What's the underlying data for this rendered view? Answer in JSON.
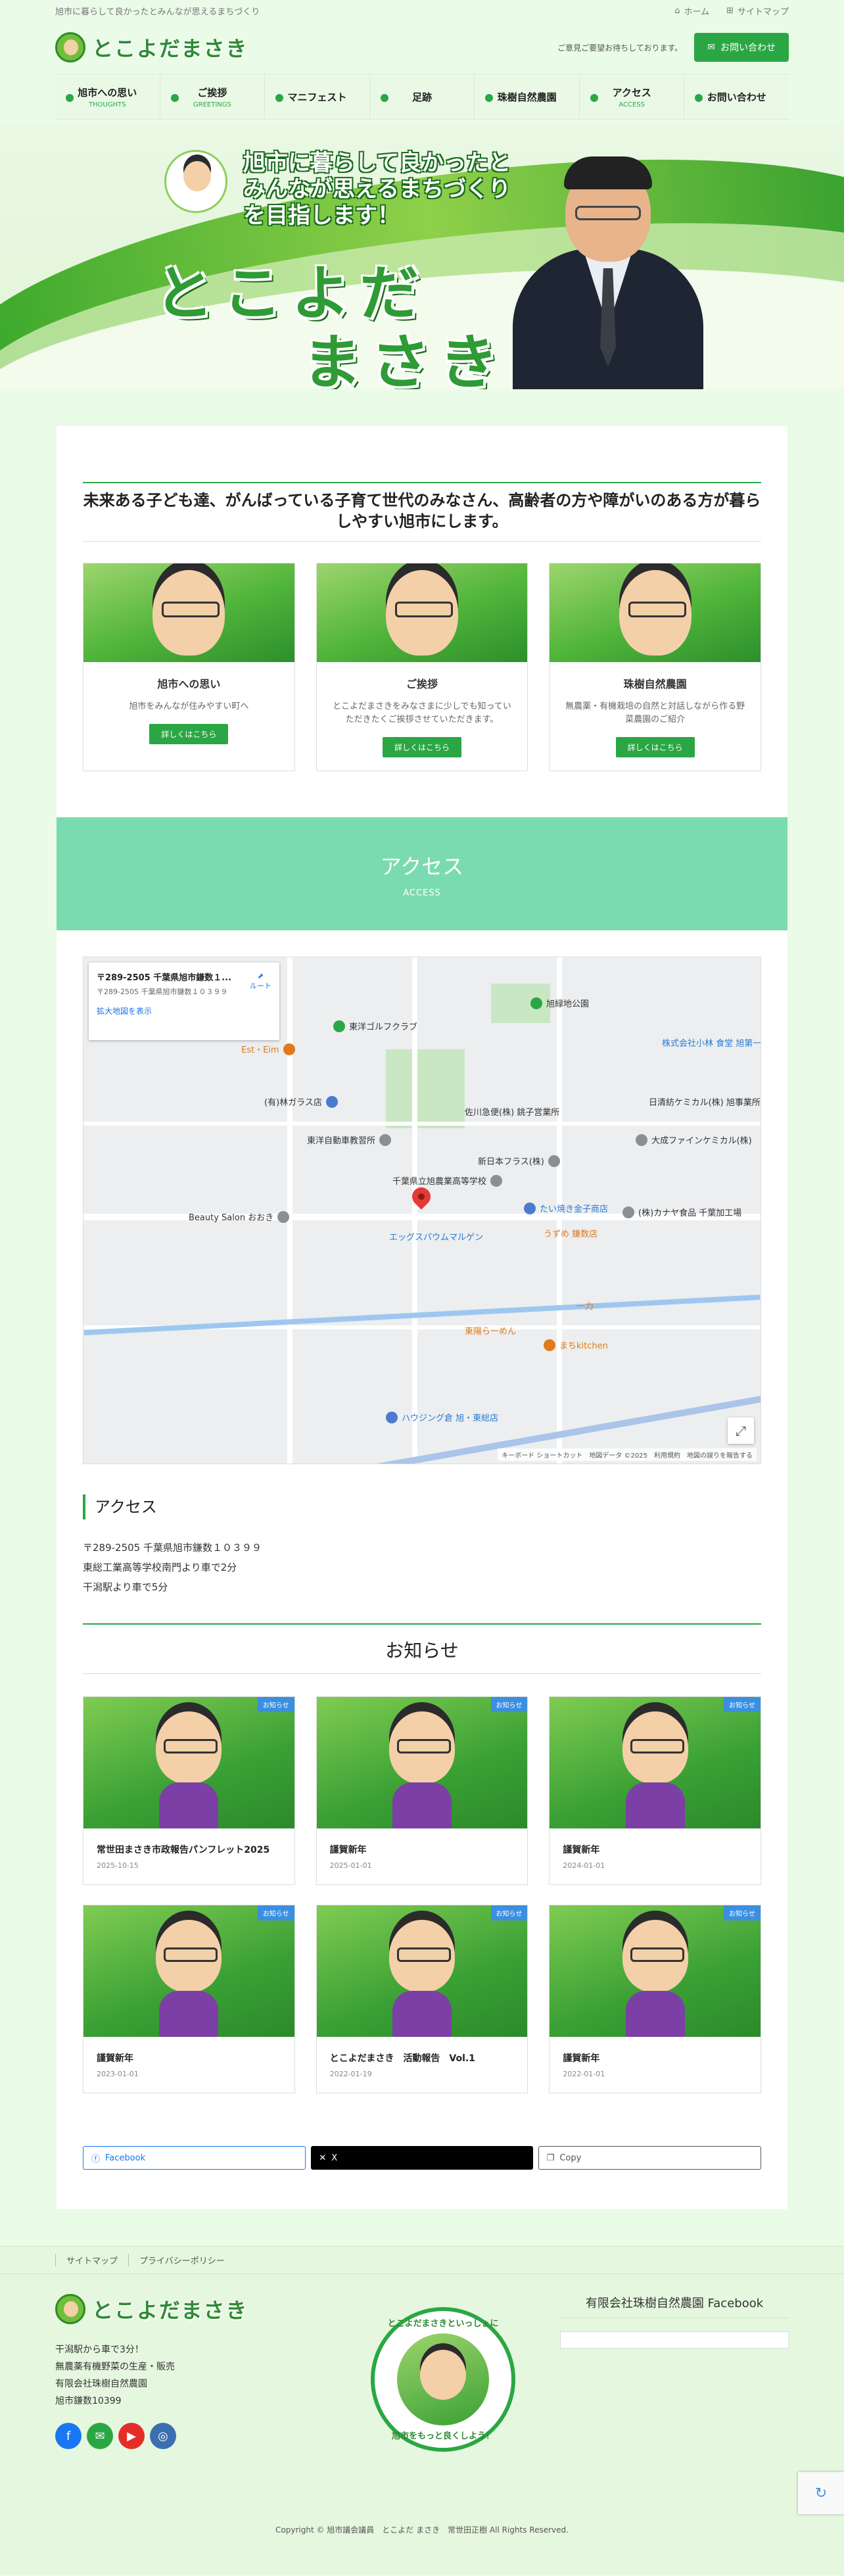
{
  "topbar": {
    "tagline": "旭市に暮らして良かったとみんなが思えるまちづくり",
    "home": "ホーム",
    "sitemap": "サイトマップ"
  },
  "header": {
    "logo_text": "とこよだまさき",
    "contact_note": "ご意見ご要望お待ちしております。",
    "contact_button": "お問い合わせ"
  },
  "nav": [
    {
      "label": "旭市への思い",
      "sub": "THOUGHTS"
    },
    {
      "label": "ご挨拶",
      "sub": "GREETINGS"
    },
    {
      "label": "マニフェスト",
      "sub": ""
    },
    {
      "label": "足跡",
      "sub": ""
    },
    {
      "label": "珠樹自然農園",
      "sub": ""
    },
    {
      "label": "アクセス",
      "sub": "ACCESS"
    },
    {
      "label": "お問い合わせ",
      "sub": ""
    }
  ],
  "hero": {
    "line1": "旭市に暮らして良かったと",
    "line2": "みんなが思えるまちづくり",
    "line3": "を目指します！",
    "name1": "とこよだ",
    "name2": "まさき"
  },
  "intro": {
    "heading": "未来ある子ども達、がんばっている子育て世代のみなさん、高齢者の方や障がいのある方が暮らしやすい旭市にします。"
  },
  "cards": [
    {
      "title": "旭市への思い",
      "text": "旭市をみんなが住みやすい町へ",
      "button": "詳しくはこちら"
    },
    {
      "title": "ご挨拶",
      "text": "とこよだまさきをみなさまに少しでも知っていただきたくご挨拶させていただきます。",
      "button": "詳しくはこちら"
    },
    {
      "title": "珠樹自然農園",
      "text": "無農薬・有機栽培の自然と対話しながら作る野菜農園のご紹介",
      "button": "詳しくはこちら"
    }
  ],
  "access_banner": {
    "title": "アクセス",
    "sub": "ACCESS"
  },
  "map": {
    "info_title": "〒289-2505 千葉県旭市鎌数１...",
    "info_addr": "〒289-2505 千葉県旭市鎌数１０３９９",
    "info_link": "拡大地図を表示",
    "route": "ルート",
    "attribution": "キーボード ショートカット　地図データ ©2025　利用規約　地図の誤りを報告する",
    "pois": [
      "旭緑地公園",
      "東洋ゴルフクラブ",
      "(有)林ガラス店",
      "東洋自動車教習所",
      "Beauty Salon おおき",
      "千葉県立旭農業高等学校",
      "エッグスパウムマルゲン",
      "たい焼き金子商店",
      "うずめ 鎌数店",
      "(株)カナヤ食品 千葉加工場",
      "大成ファインケミカル(株)",
      "日清紡ケミカル(株) 旭事業所",
      "東陽らーめん",
      "まちkitchen",
      "一力",
      "ハウジング倉 旭・東総店",
      "株式会社小林 食堂 旭第一工場",
      "Est・Eim",
      "新日本フラス(株)",
      "佐川急便(株) 銚子営業所"
    ]
  },
  "access": {
    "heading": "アクセス",
    "line1": "〒289-2505 千葉県旭市鎌数１０３９９",
    "line2": "東総工業高等学校南門より車で2分",
    "line3": "干潟駅より車で5分"
  },
  "news": {
    "heading": "お知らせ",
    "tag": "お知らせ",
    "items": [
      {
        "title": "常世田まさき市政報告パンフレット2025",
        "date": "2025-10-15"
      },
      {
        "title": "謹賀新年",
        "date": "2025-01-01"
      },
      {
        "title": "謹賀新年",
        "date": "2024-01-01"
      },
      {
        "title": "謹賀新年",
        "date": "2023-01-01"
      },
      {
        "title": "とこよだまさき　活動報告　Vol.1",
        "date": "2022-01-19"
      },
      {
        "title": "謹賀新年",
        "date": "2022-01-01"
      }
    ]
  },
  "share": {
    "facebook": "Facebook",
    "x": "X",
    "copy": "Copy"
  },
  "footer": {
    "links": [
      "サイトマップ",
      "プライバシーポリシー"
    ],
    "logo_text": "とこよだまさき",
    "addr1": "干潟駅から車で3分！",
    "addr2": "無農薬有機野菜の生産・販売",
    "addr3": "有限会社珠樹自然農園",
    "addr4": "旭市鎌数10399",
    "badge_top": "とこよだまさきといっしょに",
    "badge_bottom": "旭市をもっと良くしよう！",
    "facebook_title": "有限会社珠樹自然農園 Facebook",
    "copyright": "Copyright © 旭市議会議員　とこよだ まさき　常世田正樹 All Rights Reserved."
  },
  "colors": {
    "accent": "#2aa744",
    "banner": "#7bdbb0",
    "tag": "#3b8fe0"
  }
}
